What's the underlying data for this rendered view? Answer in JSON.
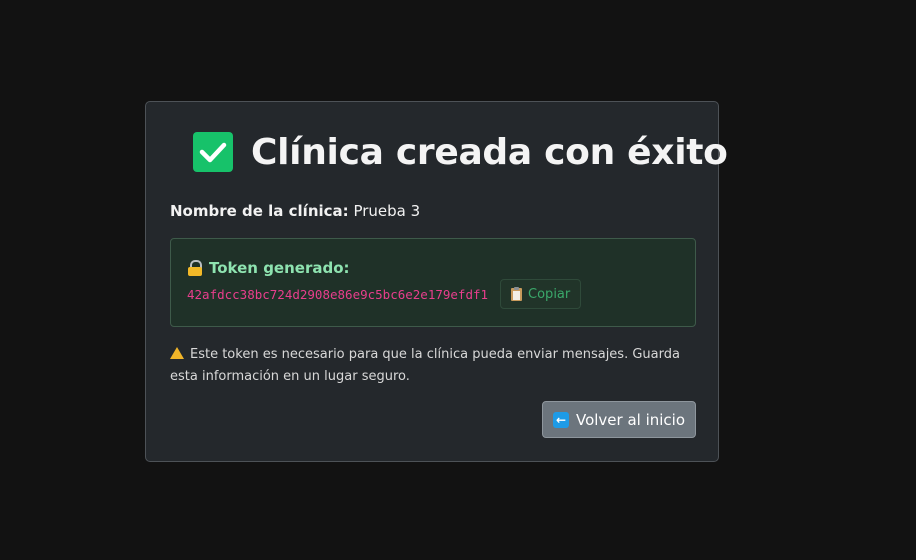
{
  "title": "Clínica creada con éxito",
  "clinic": {
    "name_label": "Nombre de la clínica:",
    "name_value": "Prueba 3"
  },
  "token": {
    "heading": "Token generado:",
    "value": "42afdcc38bc724d2908e86e9c5bc6e2e179efdf1",
    "copy_label": "Copiar"
  },
  "warning": "Este token es necesario para que la clínica pueda enviar mensajes. Guarda esta información en un lugar seguro.",
  "back_button": "Volver al inicio",
  "colors": {
    "page_bg": "#121212",
    "card_bg": "#24282c",
    "success": "#17c26a",
    "token_text": "#e83e8c",
    "token_heading": "#8ee3b0",
    "button_bg": "#6c757d"
  },
  "icons": [
    "check-mark-icon",
    "lock-icon",
    "clipboard-icon",
    "warning-icon",
    "left-arrow-icon"
  ]
}
